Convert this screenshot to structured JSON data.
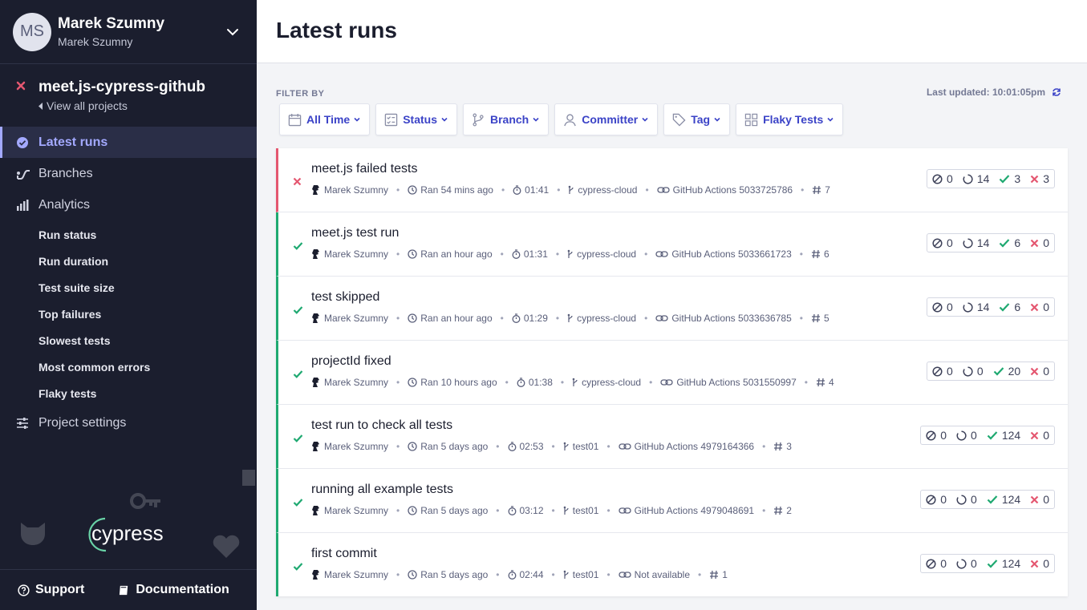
{
  "user": {
    "initials": "MS",
    "name": "Marek Szumny",
    "org": "Marek Szumny"
  },
  "project": {
    "name": "meet.js-cypress-github",
    "view_all": "View all projects"
  },
  "nav": {
    "latest_runs": "Latest runs",
    "branches": "Branches",
    "analytics": "Analytics",
    "analytics_items": [
      "Run status",
      "Run duration",
      "Test suite size",
      "Top failures",
      "Slowest tests",
      "Most common errors",
      "Flaky tests"
    ],
    "project_settings": "Project settings"
  },
  "brand": "cypress",
  "footer": {
    "support": "Support",
    "documentation": "Documentation"
  },
  "main": {
    "title": "Latest runs",
    "filter_by": "FILTER BY",
    "last_updated": "Last updated: 10:01:05pm",
    "filters": [
      "All Time",
      "Status",
      "Branch",
      "Committer",
      "Tag",
      "Flaky Tests"
    ]
  },
  "runs": [
    {
      "status": "failed",
      "title": "meet.js failed tests",
      "author": "Marek Szumny",
      "ran": "Ran 54 mins ago",
      "duration": "01:41",
      "branch": "cypress-cloud",
      "ci": "GitHub Actions 5033725786",
      "number": "7",
      "skipped": "0",
      "pending": "14",
      "passed": "3",
      "failed": "3"
    },
    {
      "status": "passed",
      "title": "meet.js test run",
      "author": "Marek Szumny",
      "ran": "Ran an hour ago",
      "duration": "01:31",
      "branch": "cypress-cloud",
      "ci": "GitHub Actions 5033661723",
      "number": "6",
      "skipped": "0",
      "pending": "14",
      "passed": "6",
      "failed": "0"
    },
    {
      "status": "passed",
      "title": "test skipped",
      "author": "Marek Szumny",
      "ran": "Ran an hour ago",
      "duration": "01:29",
      "branch": "cypress-cloud",
      "ci": "GitHub Actions 5033636785",
      "number": "5",
      "skipped": "0",
      "pending": "14",
      "passed": "6",
      "failed": "0"
    },
    {
      "status": "passed",
      "title": "projectId fixed",
      "author": "Marek Szumny",
      "ran": "Ran 10 hours ago",
      "duration": "01:38",
      "branch": "cypress-cloud",
      "ci": "GitHub Actions 5031550997",
      "number": "4",
      "skipped": "0",
      "pending": "0",
      "passed": "20",
      "failed": "0"
    },
    {
      "status": "passed",
      "title": "test run to check all tests",
      "author": "Marek Szumny",
      "ran": "Ran 5 days ago",
      "duration": "02:53",
      "branch": "test01",
      "ci": "GitHub Actions 4979164366",
      "number": "3",
      "skipped": "0",
      "pending": "0",
      "passed": "124",
      "failed": "0"
    },
    {
      "status": "passed",
      "title": "running all example tests",
      "author": "Marek Szumny",
      "ran": "Ran 5 days ago",
      "duration": "03:12",
      "branch": "test01",
      "ci": "GitHub Actions 4979048691",
      "number": "2",
      "skipped": "0",
      "pending": "0",
      "passed": "124",
      "failed": "0"
    },
    {
      "status": "passed",
      "title": "first commit",
      "author": "Marek Szumny",
      "ran": "Ran 5 days ago",
      "duration": "02:44",
      "branch": "test01",
      "ci": "Not available",
      "number": "1",
      "skipped": "0",
      "pending": "0",
      "passed": "124",
      "failed": "0"
    }
  ],
  "colors": {
    "sidebar_bg": "#1b1e2e",
    "accent": "#3b43c7",
    "passed": "#1fa971",
    "failed": "#e45770",
    "active_nav": "#a3a9ff"
  }
}
